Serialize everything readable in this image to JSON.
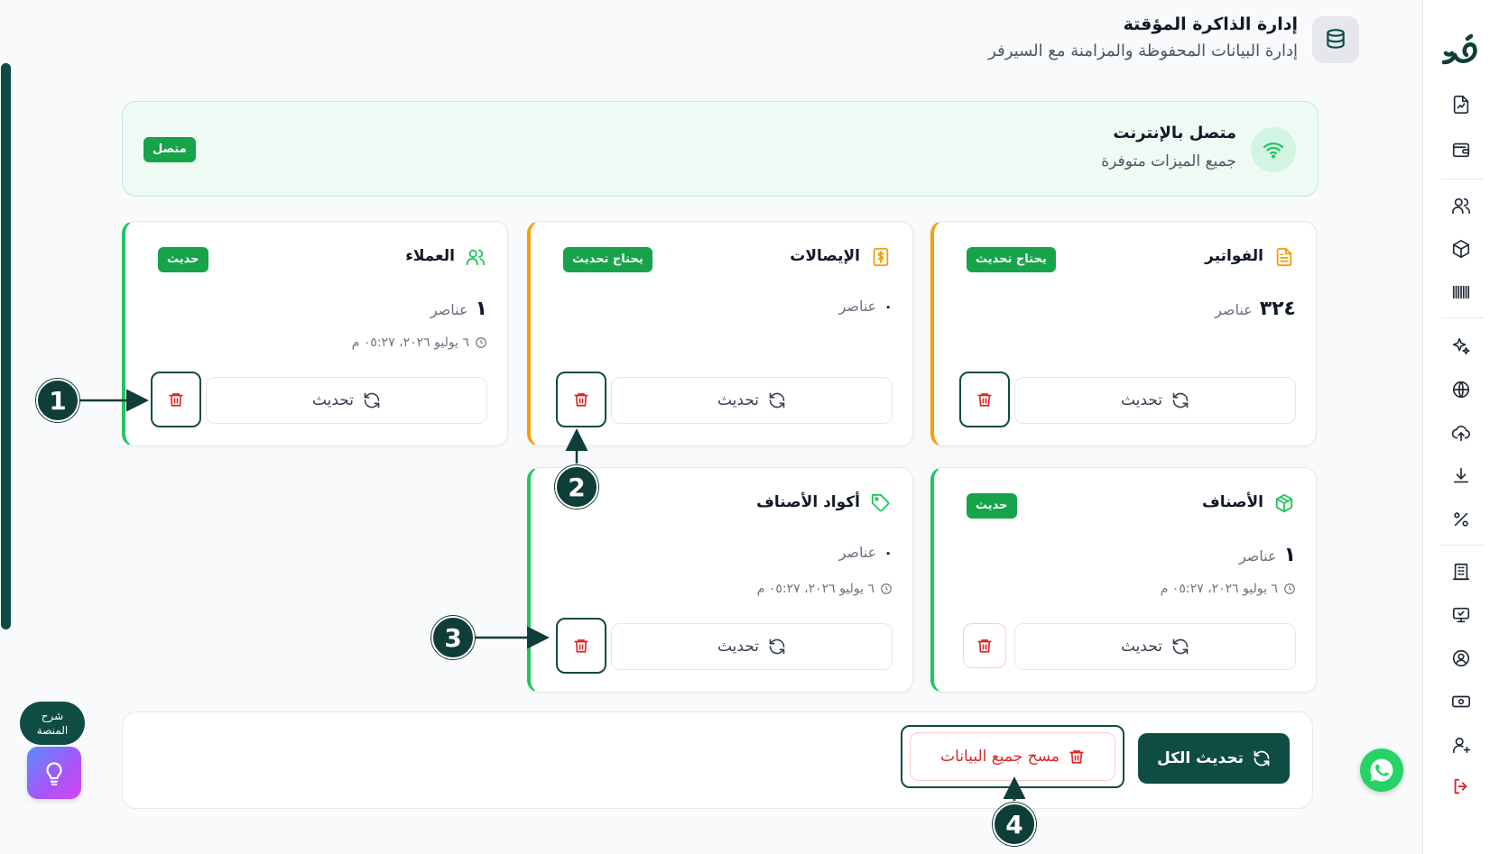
{
  "header": {
    "title": "إدارة الذاكرة المؤقتة",
    "subtitle": "إدارة البيانات المحفوظة والمزامنة مع السيرفر",
    "icon": "database-icon"
  },
  "connection": {
    "title": "متصل بالإنترنت",
    "subtitle": "جميع الميزات متوفرة",
    "badge": "متصل",
    "icon": "wifi-icon"
  },
  "cards": [
    {
      "key": "invoices",
      "title": "الفواتير",
      "icon": "file-text-icon",
      "icon_color": "#f59e0b",
      "badge": "يحتاج تحديث",
      "status": "stale",
      "count": "٣٢٤",
      "count_label": "عناصر",
      "time": "",
      "refresh_label": "تحديث"
    },
    {
      "key": "receipts",
      "title": "الإيصالات",
      "icon": "receipt-dollar-icon",
      "icon_color": "#f59e0b",
      "badge": "يحتاج تحديث",
      "status": "stale",
      "count": "٠",
      "count_label": "عناصر",
      "time": "",
      "refresh_label": "تحديث"
    },
    {
      "key": "customers",
      "title": "العملاء",
      "icon": "users-icon",
      "icon_color": "#22c55e",
      "badge": "حديث",
      "status": "ok",
      "count": "١",
      "count_label": "عناصر",
      "time": "٦ يوليو ٢٠٢٦، ٠٥:٢٧ م",
      "refresh_label": "تحديث"
    },
    {
      "key": "products",
      "title": "الأصناف",
      "icon": "package-icon",
      "icon_color": "#22c55e",
      "badge": "حديث",
      "status": "ok",
      "count": "١",
      "count_label": "عناصر",
      "time": "٦ يوليو ٢٠٢٦، ٠٥:٢٧ م",
      "refresh_label": "تحديث"
    },
    {
      "key": "product_codes",
      "title": "أكواد الأصناف",
      "icon": "tag-icon",
      "icon_color": "#22c55e",
      "badge": "",
      "status": "ok",
      "count": "٠",
      "count_label": "عناصر",
      "time": "٦ يوليو ٢٠٢٦، ٠٥:٢٧ م",
      "refresh_label": "تحديث"
    }
  ],
  "actions": {
    "refresh_all": "تحديث الكل",
    "clear_all": "مسح جميع البيانات"
  },
  "callouts": [
    "1",
    "2",
    "3",
    "4"
  ],
  "help": {
    "line1": "شرح",
    "line2": "المنصة"
  },
  "sidebar": {
    "logo": "brand-logo",
    "items": [
      "reports-icon",
      "wallet-icon",
      "users-icon",
      "package-icon",
      "barcode-icon",
      "sparkles-icon",
      "globe-icon",
      "cloud-upload-icon",
      "download-icon",
      "percent-icon",
      "building-icon",
      "monitor-check-icon",
      "user-circle-icon",
      "banknote-icon",
      "user-plus-icon",
      "logout-icon"
    ]
  },
  "colors": {
    "primary": "#0f4c44",
    "success": "#16a34a",
    "warning": "#f59e0b",
    "danger": "#dc2626"
  }
}
